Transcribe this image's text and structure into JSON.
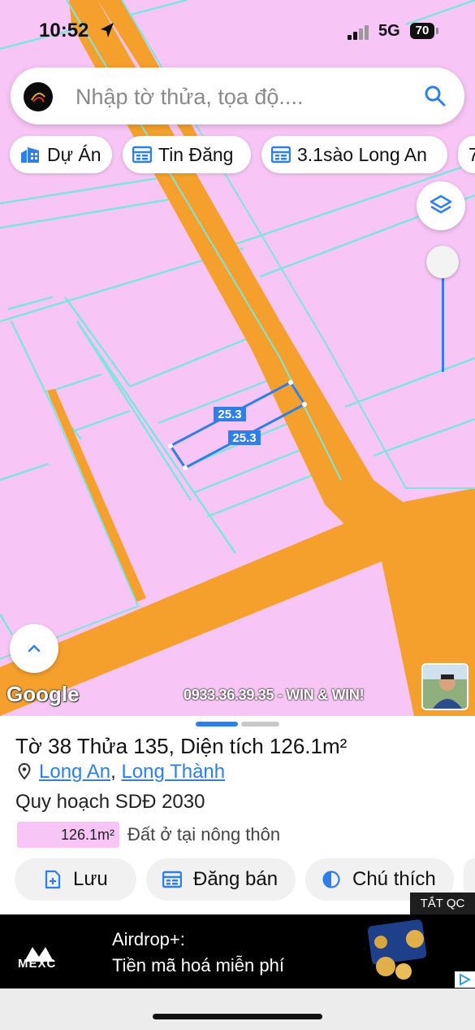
{
  "status_bar": {
    "time": "10:52",
    "network": "5G",
    "battery": "70"
  },
  "search": {
    "placeholder": "Nhập tờ thửa, tọa độ...."
  },
  "chips": [
    {
      "label": "Dự Án",
      "icon": "building-icon"
    },
    {
      "label": "Tin Đăng",
      "icon": "listing-icon"
    },
    {
      "label": "3.1sào Long An",
      "icon": "listing-icon"
    },
    {
      "label": "7",
      "icon": ""
    }
  ],
  "map": {
    "dimension_labels": [
      "25.3",
      "25.3"
    ],
    "google_label": "Google",
    "watermark": "0933.36.39.35 - WIN & WIN!",
    "colors": {
      "land": "#f8c6f6",
      "road": "#f5a02c",
      "boundary": "#7fe5dc",
      "highlight": "#2f7fe8"
    }
  },
  "parcel": {
    "title": "Tờ 38 Thửa 135, Diện tích 126.1m²",
    "province": "Long An",
    "separator": ", ",
    "district": "Long Thành",
    "plan_label": "Quy hoạch SDĐ 2030",
    "area_value": "126.1m²",
    "land_type": "Đất ở tại nông thôn"
  },
  "actions": [
    {
      "label": "Lưu",
      "icon": "save-icon"
    },
    {
      "label": "Đăng bán",
      "icon": "post-icon"
    },
    {
      "label": "Chú thích",
      "icon": "legend-icon"
    }
  ],
  "ad": {
    "close_label": "TẮT QC",
    "brand": "MEXC",
    "title": "Airdrop+:",
    "subtitle": "Tiền mã hoá miễn phí"
  }
}
